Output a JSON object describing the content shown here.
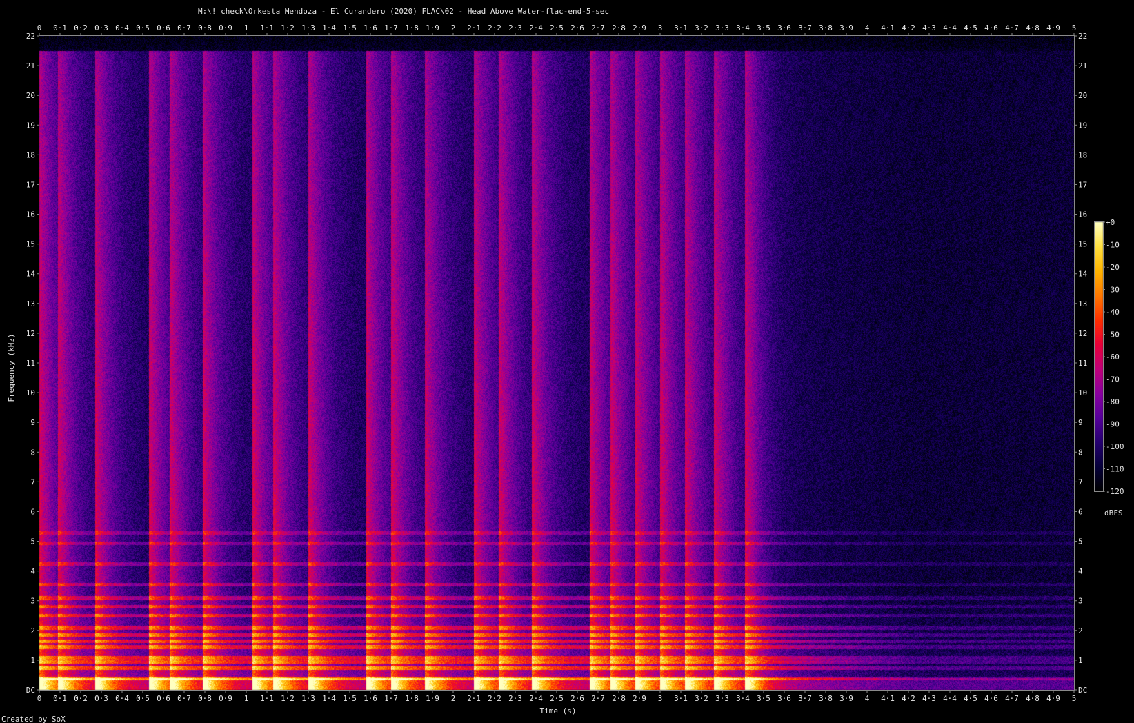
{
  "title": "M:\\! check\\Orkesta Mendoza - El Curandero (2020) FLAC\\02 - Head Above Water-flac-end-5-sec",
  "credit": "Created by SoX",
  "chart_data": {
    "type": "heatmap",
    "title": "M:\\! check\\Orkesta Mendoza - El Curandero (2020) FLAC\\02 - Head Above Water-flac-end-5-sec",
    "xlabel": "Time (s)",
    "ylabel": "Frequency (kHz)",
    "xlim": [
      0,
      5
    ],
    "ylim": [
      0,
      22
    ],
    "x_ticks": [
      "0",
      "0·1",
      "0·2",
      "0·3",
      "0·4",
      "0·5",
      "0·6",
      "0·7",
      "0·8",
      "0·9",
      "1",
      "1·1",
      "1·2",
      "1·3",
      "1·4",
      "1·5",
      "1·6",
      "1·7",
      "1·8",
      "1·9",
      "2",
      "2·1",
      "2·2",
      "2·3",
      "2·4",
      "2·5",
      "2·6",
      "2·7",
      "2·8",
      "2·9",
      "3",
      "3·1",
      "3·2",
      "3·3",
      "3·4",
      "3·5",
      "3·6",
      "3·7",
      "3·8",
      "3·9",
      "4",
      "4·1",
      "4·2",
      "4·3",
      "4·4",
      "4·5",
      "4·6",
      "4·7",
      "4·8",
      "4·9",
      "5"
    ],
    "y_ticks": [
      "DC",
      "1",
      "2",
      "3",
      "4",
      "5",
      "6",
      "7",
      "8",
      "9",
      "10",
      "11",
      "12",
      "13",
      "14",
      "15",
      "16",
      "17",
      "18",
      "19",
      "20",
      "21",
      "22"
    ],
    "colorbar": {
      "label": "dBFS",
      "ticks": [
        "+0",
        "-10",
        "-20",
        "-30",
        "-40",
        "-50",
        "-60",
        "-70",
        "-80",
        "-90",
        "-100",
        "-110",
        "-120"
      ],
      "range": [
        -120,
        0
      ],
      "stops": [
        "#000000",
        "#06003a",
        "#250070",
        "#56009a",
        "#8a00a0",
        "#c0007a",
        "#e8003a",
        "#ff3000",
        "#ff7800",
        "#ffb400",
        "#ffe040",
        "#ffffc0"
      ]
    },
    "bandwidth_cutoff_khz": 21.5,
    "onsets_s": [
      0.0,
      0.09,
      0.27,
      0.53,
      0.63,
      0.79,
      1.03,
      1.13,
      1.3,
      1.58,
      1.7,
      1.86,
      2.1,
      2.22,
      2.38,
      2.66,
      2.76,
      2.88,
      3.0,
      3.12,
      3.26,
      3.41
    ],
    "note_lines_khz": [
      0.4,
      0.75,
      0.95,
      1.1,
      1.45,
      1.65,
      1.85,
      2.1,
      2.5,
      2.8,
      3.1,
      3.55,
      4.25,
      4.95,
      5.3
    ]
  }
}
